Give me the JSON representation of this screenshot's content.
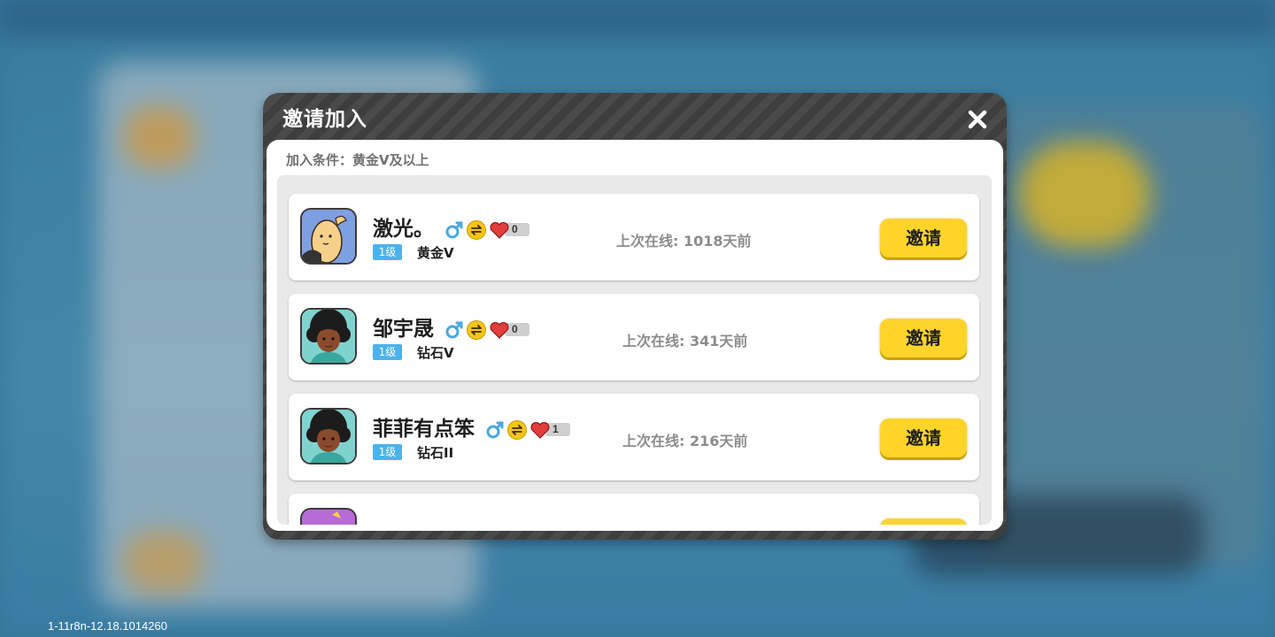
{
  "background": {
    "theme_color": "#3a7fa8"
  },
  "version_text": "1-11r8n-12.18.1014260",
  "dialog": {
    "title": "邀请加入",
    "close_icon": "close-icon",
    "condition": "加入条件：黄金V及以上",
    "players": [
      {
        "name": "激光。",
        "gender": "male",
        "hearts": "0",
        "level": "1级",
        "rank": "黄金V",
        "last_online": "上次在线: 1018天前",
        "invite_label": "邀请",
        "avatar": "bean-character-avatar"
      },
      {
        "name": "邹宇晟",
        "gender": "male",
        "hearts": "0",
        "level": "1级",
        "rank": "钻石V",
        "last_online": "上次在线: 341天前",
        "invite_label": "邀请",
        "avatar": "afro-character-avatar"
      },
      {
        "name": "菲菲有点笨",
        "gender": "male",
        "hearts": "1",
        "level": "1级",
        "rank": "钻石II",
        "last_online": "上次在线: 216天前",
        "invite_label": "邀请",
        "avatar": "afro-character-avatar"
      },
      {
        "name": "",
        "gender": "male",
        "hearts": "",
        "level": "",
        "rank": "",
        "last_online": "",
        "invite_label": "",
        "avatar": "purple-character-avatar"
      }
    ]
  },
  "colors": {
    "accent_yellow": "#ffd42a",
    "level_blue": "#4cb3ea",
    "header_dark": "#444444"
  }
}
